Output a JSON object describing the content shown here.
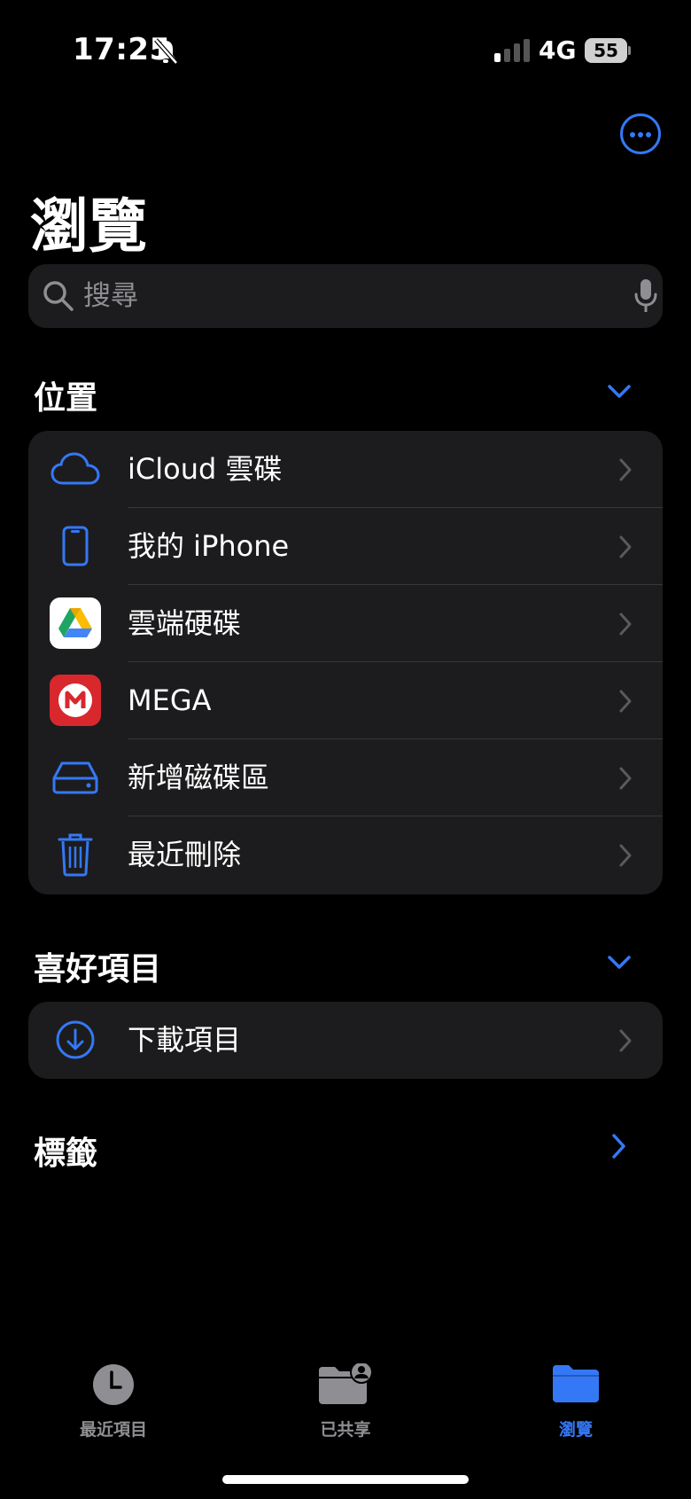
{
  "status": {
    "time": "17:25",
    "network": "4G",
    "battery": "55"
  },
  "page": {
    "title": "瀏覽"
  },
  "search": {
    "placeholder": "搜尋"
  },
  "locations": {
    "header": "位置",
    "items": [
      {
        "label": "iCloud 雲碟",
        "icon": "cloud-icon"
      },
      {
        "label": "我的 iPhone",
        "icon": "iphone-icon"
      },
      {
        "label": "雲端硬碟",
        "icon": "google-drive-icon"
      },
      {
        "label": "MEGA",
        "icon": "mega-icon"
      },
      {
        "label": "新增磁碟區",
        "icon": "drive-icon"
      },
      {
        "label": "最近刪除",
        "icon": "trash-icon"
      }
    ]
  },
  "favorites": {
    "header": "喜好項目",
    "items": [
      {
        "label": "下載項目",
        "icon": "download-icon"
      }
    ]
  },
  "tags": {
    "header": "標籤"
  },
  "tabbar": {
    "items": [
      {
        "label": "最近項目",
        "icon": "clock-icon"
      },
      {
        "label": "已共享",
        "icon": "shared-folder-icon"
      },
      {
        "label": "瀏覽",
        "icon": "folder-icon",
        "active": true
      }
    ]
  },
  "colors": {
    "accent": "#3478f6",
    "background": "#000000",
    "cell": "#1c1c1e",
    "secondary_text": "#8e8e93"
  }
}
